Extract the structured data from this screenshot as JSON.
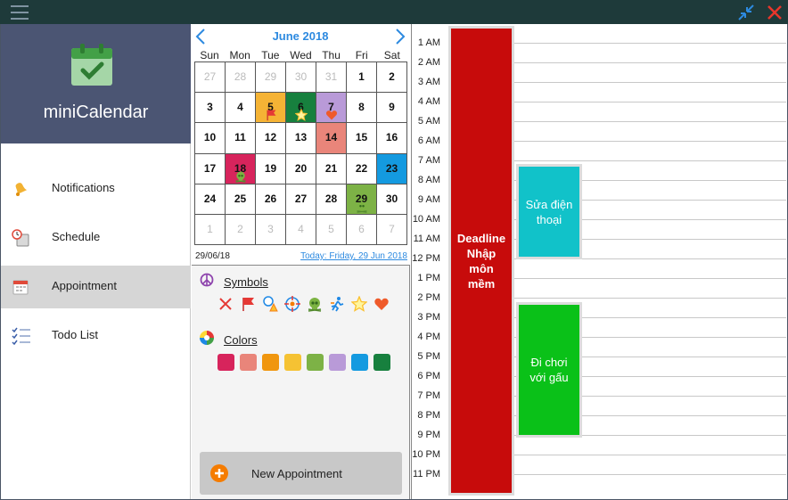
{
  "window": {
    "title_icons": [
      "hamburger-icon",
      "minimize-arrows-icon",
      "close-icon"
    ]
  },
  "sidebar": {
    "app_name": "miniCalendar",
    "items": [
      {
        "label": "Notifications",
        "icon": "bell-icon",
        "active": false
      },
      {
        "label": "Schedule",
        "icon": "clock-calendar-icon",
        "active": false
      },
      {
        "label": "Appointment",
        "icon": "calendar-icon",
        "active": true
      },
      {
        "label": "Todo List",
        "icon": "checklist-icon",
        "active": false
      }
    ]
  },
  "calendar": {
    "month_label": "June 2018",
    "weekdays": [
      "Sun",
      "Mon",
      "Tue",
      "Wed",
      "Thu",
      "Fri",
      "Sat"
    ],
    "weeks": [
      [
        {
          "d": "27",
          "muted": true
        },
        {
          "d": "28",
          "muted": true
        },
        {
          "d": "29",
          "muted": true
        },
        {
          "d": "30",
          "muted": true
        },
        {
          "d": "31",
          "muted": true
        },
        {
          "d": "1"
        },
        {
          "d": "2"
        }
      ],
      [
        {
          "d": "3"
        },
        {
          "d": "4"
        },
        {
          "d": "5",
          "bg": "#f5b335",
          "sym": "flag"
        },
        {
          "d": "6",
          "bg": "#17803e",
          "sym": "star"
        },
        {
          "d": "7",
          "bg": "#b99ad8",
          "sym": "heart"
        },
        {
          "d": "8"
        },
        {
          "d": "9"
        }
      ],
      [
        {
          "d": "10"
        },
        {
          "d": "11"
        },
        {
          "d": "12"
        },
        {
          "d": "13"
        },
        {
          "d": "14",
          "bg": "#e9857a"
        },
        {
          "d": "15"
        },
        {
          "d": "16"
        }
      ],
      [
        {
          "d": "17"
        },
        {
          "d": "18",
          "bg": "#d7245c",
          "sym": "skull"
        },
        {
          "d": "19"
        },
        {
          "d": "20"
        },
        {
          "d": "21"
        },
        {
          "d": "22"
        },
        {
          "d": "23",
          "bg": "#149ae0"
        }
      ],
      [
        {
          "d": "24"
        },
        {
          "d": "25"
        },
        {
          "d": "26"
        },
        {
          "d": "27"
        },
        {
          "d": "28"
        },
        {
          "d": "29",
          "bg": "#7db246",
          "sym": "skull"
        },
        {
          "d": "30"
        }
      ],
      [
        {
          "d": "1",
          "muted": true
        },
        {
          "d": "2",
          "muted": true
        },
        {
          "d": "3",
          "muted": true
        },
        {
          "d": "4",
          "muted": true
        },
        {
          "d": "5",
          "muted": true
        },
        {
          "d": "6",
          "muted": true
        },
        {
          "d": "7",
          "muted": true
        }
      ]
    ],
    "selected_date": "29/06/18",
    "today_link": "Today: Friday, 29 Jun 2018"
  },
  "styles_panel": {
    "symbols_label": "Symbols",
    "symbols": [
      "x-icon",
      "flag-icon",
      "warning-icon",
      "target-icon",
      "skull-icon",
      "runner-icon",
      "star-icon",
      "heart-icon"
    ],
    "colors_label": "Colors",
    "colors": [
      "#d7245c",
      "#e9857a",
      "#f0960e",
      "#f5c233",
      "#7db246",
      "#b99ad8",
      "#149ae0",
      "#17803e"
    ],
    "new_button": "New Appointment"
  },
  "day_view": {
    "hours": [
      "1 AM",
      "2 AM",
      "3 AM",
      "4 AM",
      "5 AM",
      "6 AM",
      "7 AM",
      "8 AM",
      "9 AM",
      "10 AM",
      "11 AM",
      "12 PM",
      "1 PM",
      "2 PM",
      "3 PM",
      "4 PM",
      "5 PM",
      "6 PM",
      "7 PM",
      "8 PM",
      "9 PM",
      "10 PM",
      "11 PM"
    ],
    "appointments": [
      {
        "title": "Deadline Nhập môn mềm",
        "color": "#c70b0b"
      },
      {
        "title": "Sửa điện thoại",
        "color": "#11c2c9"
      },
      {
        "title": "Đi chơi với gấu",
        "color": "#0ac118"
      }
    ]
  }
}
